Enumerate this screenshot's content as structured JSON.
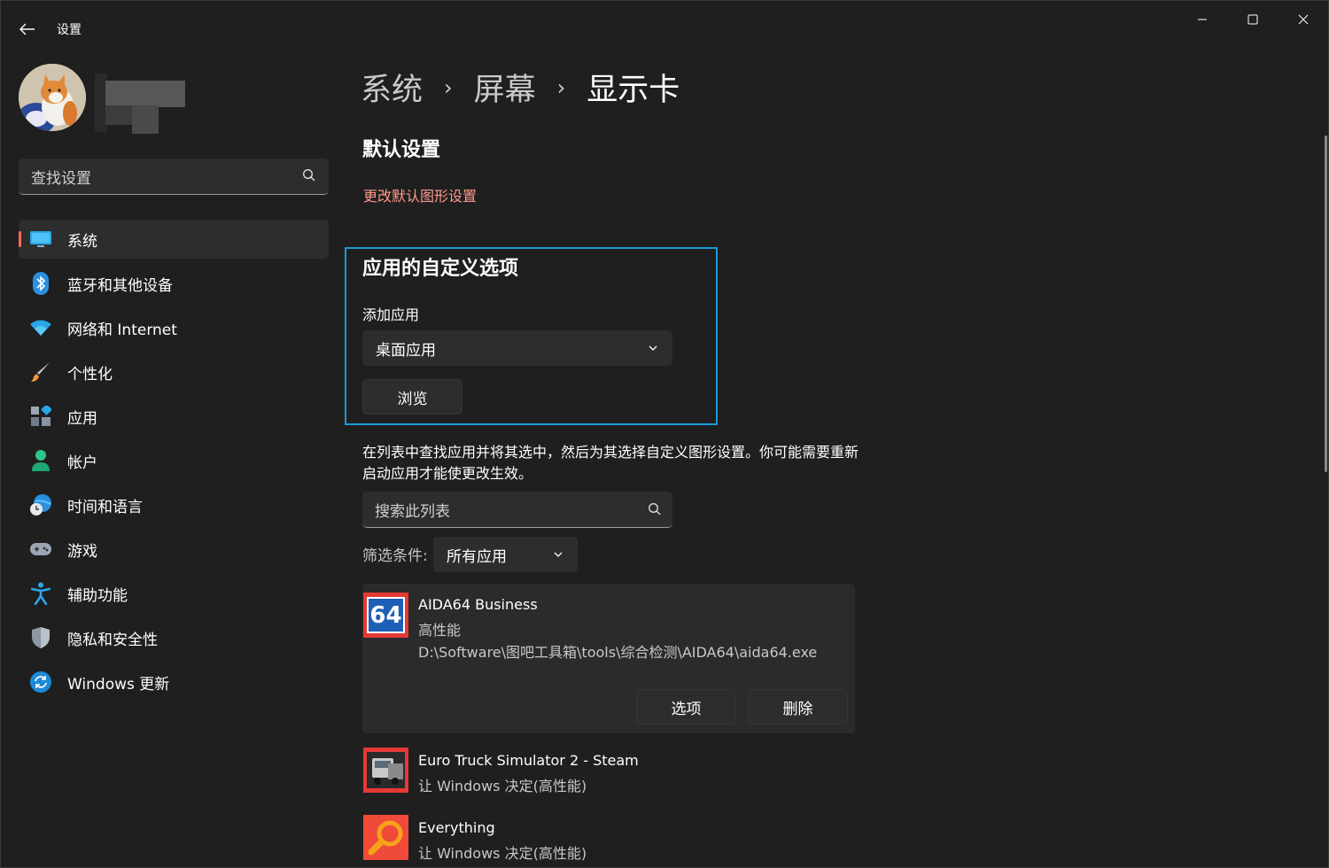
{
  "window": {
    "title": "设置",
    "controls": {
      "minimize": "minimize-icon",
      "maximize": "maximize-icon",
      "close": "close-icon"
    }
  },
  "sidebar": {
    "search_placeholder": "查找设置",
    "items": [
      {
        "label": "系统",
        "icon": "monitor-icon",
        "active": true
      },
      {
        "label": "蓝牙和其他设备",
        "icon": "bluetooth-icon"
      },
      {
        "label": "网络和 Internet",
        "icon": "wifi-icon"
      },
      {
        "label": "个性化",
        "icon": "brush-icon"
      },
      {
        "label": "应用",
        "icon": "apps-icon"
      },
      {
        "label": "帐户",
        "icon": "person-icon"
      },
      {
        "label": "时间和语言",
        "icon": "globe-clock-icon"
      },
      {
        "label": "游戏",
        "icon": "gamepad-icon"
      },
      {
        "label": "辅助功能",
        "icon": "accessibility-icon"
      },
      {
        "label": "隐私和安全性",
        "icon": "shield-icon"
      },
      {
        "label": "Windows 更新",
        "icon": "update-icon"
      }
    ]
  },
  "main": {
    "breadcrumb": [
      "系统",
      "屏幕",
      "显示卡"
    ],
    "breadcrumb_sep": "›",
    "default_section": {
      "title": "默认设置",
      "link": "更改默认图形设置"
    },
    "custom_section": {
      "title": "应用的自定义选项",
      "add_label": "添加应用",
      "app_type": "桌面应用",
      "browse_button": "浏览"
    },
    "description": "在列表中查找应用并将其选中，然后为其选择自定义图形设置。你可能需要重新启动应用才能使更改生效。",
    "list_search_placeholder": "搜索此列表",
    "filter": {
      "label": "筛选条件:",
      "value": "所有应用"
    },
    "apps": [
      {
        "name": "AIDA64 Business",
        "setting": "高性能",
        "path": "D:\\Software\\图吧工具箱\\tools\\综合检测\\AIDA64\\aida64.exe",
        "icon_text": "64",
        "options_button": "选项",
        "delete_button": "删除"
      },
      {
        "name": "Euro Truck Simulator 2 - Steam",
        "setting": "让 Windows 决定(高性能)"
      },
      {
        "name": "Everything",
        "setting": "让 Windows 决定(高性能)"
      }
    ]
  },
  "colors": {
    "accent": "#ff6a5c",
    "link": "#ff9a8c",
    "focus": "#1b9bd8",
    "background": "#202020",
    "card": "#2d2d2d"
  }
}
